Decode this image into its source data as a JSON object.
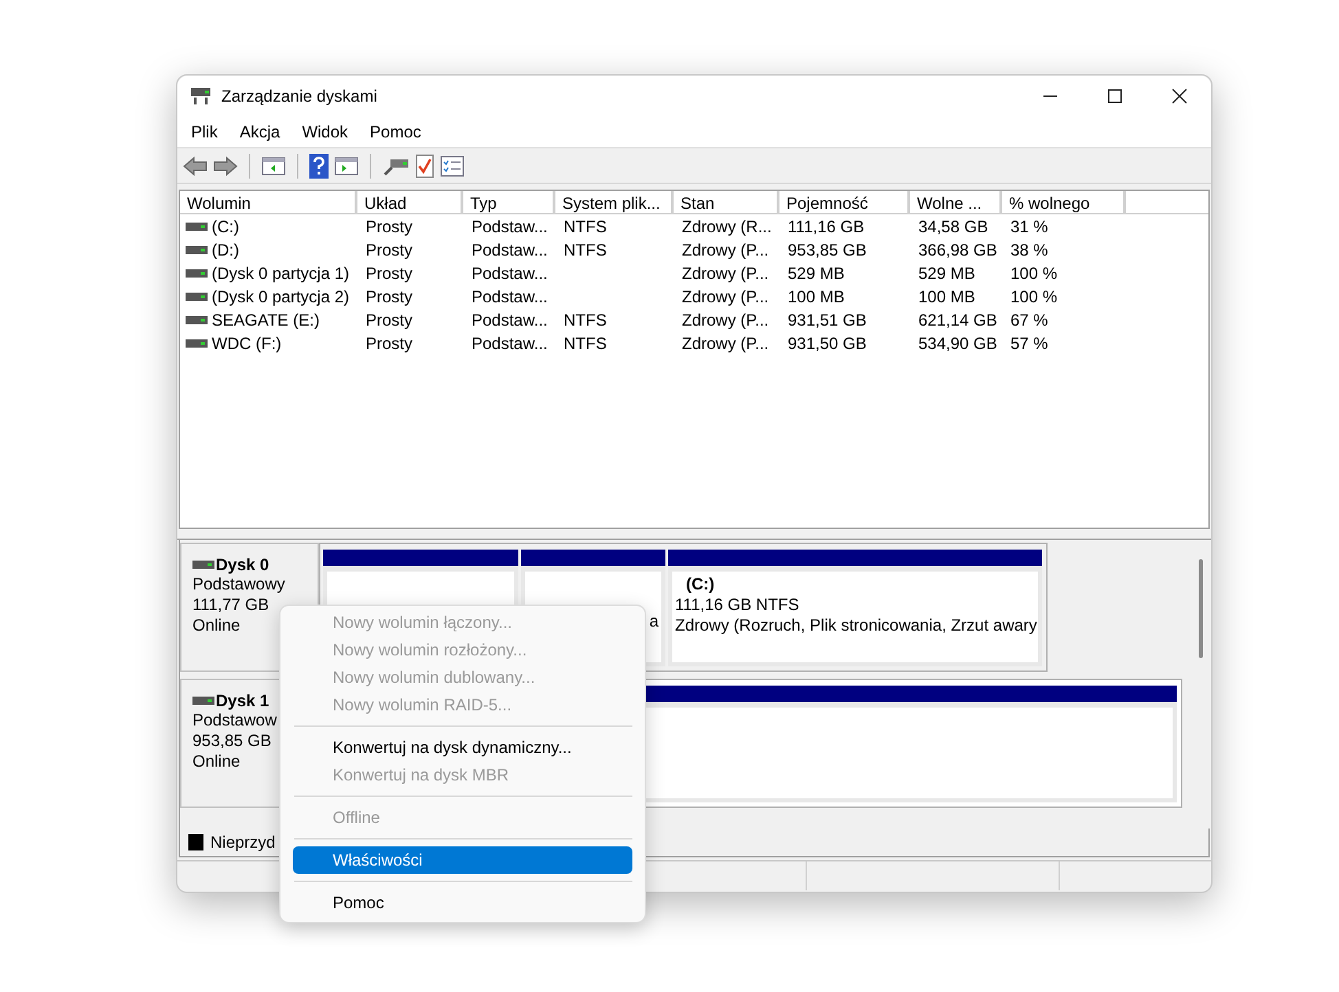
{
  "window": {
    "title": "Zarządzanie dyskami"
  },
  "menu_bar": [
    "Plik",
    "Akcja",
    "Widok",
    "Pomoc"
  ],
  "volume_table": {
    "columns": [
      "Wolumin",
      "Układ",
      "Typ",
      "System plik...",
      "Stan",
      "Pojemność",
      "Wolne ...",
      "% wolnego"
    ],
    "rows": [
      {
        "cells": [
          " (C:)",
          "Prosty",
          "Podstaw...",
          "NTFS",
          "Zdrowy (R...",
          "111,16 GB",
          "34,58 GB",
          "31 %"
        ]
      },
      {
        "cells": [
          " (D:)",
          "Prosty",
          "Podstaw...",
          "NTFS",
          "Zdrowy (P...",
          "953,85 GB",
          "366,98 GB",
          "38 %"
        ]
      },
      {
        "cells": [
          "(Dysk 0 partycja 1)",
          "Prosty",
          "Podstaw...",
          "",
          "Zdrowy (P...",
          "529 MB",
          "529 MB",
          "100 %"
        ]
      },
      {
        "cells": [
          "(Dysk 0 partycja 2)",
          "Prosty",
          "Podstaw...",
          "",
          "Zdrowy (P...",
          "100 MB",
          "100 MB",
          "100 %"
        ]
      },
      {
        "cells": [
          "SEAGATE (E:)",
          "Prosty",
          "Podstaw...",
          "NTFS",
          "Zdrowy (P...",
          "931,51 GB",
          "621,14 GB",
          "67 %"
        ]
      },
      {
        "cells": [
          "WDC (F:)",
          "Prosty",
          "Podstaw...",
          "NTFS",
          "Zdrowy (P...",
          "931,50 GB",
          "534,90 GB",
          "57 %"
        ]
      }
    ]
  },
  "disks": [
    {
      "name": "Dysk 0",
      "lines": [
        "Podstawowy",
        "111,77 GB",
        "Online"
      ],
      "partitions": [
        {
          "kind": "primary"
        },
        {
          "kind": "primary",
          "lines": [
            "a"
          ]
        },
        {
          "kind": "primary",
          "title": "(C:)",
          "lines": [
            "111,16 GB NTFS",
            "Zdrowy (Rozruch, Plik stronicowania, Zrzut awary"
          ]
        }
      ]
    },
    {
      "name": "Dysk 1",
      "lines": [
        "Podstawow",
        "953,85 GB",
        "Online"
      ],
      "partitions": [
        {
          "kind": "primary"
        }
      ]
    }
  ],
  "legend": [
    {
      "label": "Nieprzyd",
      "color": "#000000"
    }
  ],
  "context_menu": [
    {
      "kind": "item",
      "label": "Nowy wolumin łączony...",
      "disabled": true,
      "selected": false
    },
    {
      "kind": "item",
      "label": "Nowy wolumin rozłożony...",
      "disabled": true,
      "selected": false
    },
    {
      "kind": "item",
      "label": "Nowy wolumin dublowany...",
      "disabled": true,
      "selected": false
    },
    {
      "kind": "item",
      "label": "Nowy wolumin RAID-5...",
      "disabled": true,
      "selected": false
    },
    {
      "kind": "separator"
    },
    {
      "kind": "item",
      "label": "Konwertuj na dysk dynamiczny...",
      "disabled": false,
      "selected": false
    },
    {
      "kind": "item",
      "label": "Konwertuj na dysk MBR",
      "disabled": true,
      "selected": false
    },
    {
      "kind": "separator"
    },
    {
      "kind": "item",
      "label": "Offline",
      "disabled": true,
      "selected": false
    },
    {
      "kind": "separator"
    },
    {
      "kind": "item",
      "label": "Właściwości",
      "disabled": false,
      "selected": true
    },
    {
      "kind": "separator"
    },
    {
      "kind": "item",
      "label": "Pomoc",
      "disabled": false,
      "selected": false
    }
  ]
}
